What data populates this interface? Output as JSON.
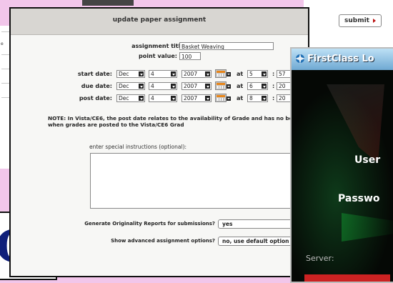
{
  "main": {
    "title": "update paper assignment",
    "submit_label": "submit",
    "fields": {
      "title_label": "assignment title:",
      "title_value": "Basket Weaving",
      "points_label": "point value:",
      "points_value": "100"
    },
    "dates": [
      {
        "label": "start date:",
        "month": "Dec",
        "day": "4",
        "year": "2007",
        "at": "at",
        "hour": "5",
        "minute": "57"
      },
      {
        "label": "due date:",
        "month": "Dec",
        "day": "4",
        "year": "2007",
        "at": "at",
        "hour": "6",
        "minute": "20"
      },
      {
        "label": "post date:",
        "month": "Dec",
        "day": "4",
        "year": "2007",
        "at": "at",
        "hour": "8",
        "minute": "20"
      }
    ],
    "note": "NOTE: In Vista/CE6, the post date relates to the availability of Grade and has no bearing on when grades are posted to the Vista/CE6 Grad",
    "instructions_label": "enter special instructions (optional):",
    "originality_label": "Generate Originality Reports for submissions?",
    "originality_value": "yes",
    "advanced_label": "Show advanced assignment options?",
    "advanced_value": "no, use default option"
  },
  "firstclass": {
    "title": "FirstClass Lo",
    "user_label": "User",
    "password_label": "Passwo",
    "server_label": "Server:"
  },
  "background": {
    "ct_logo": "CT",
    "left_text": "e"
  },
  "colors": {
    "background": "#f2c6ea",
    "header": "#d8d6d2",
    "submit_caret": "#b11111",
    "ct_logo": "#0f1f7a",
    "firstclass_title": "#6fa9d3"
  }
}
